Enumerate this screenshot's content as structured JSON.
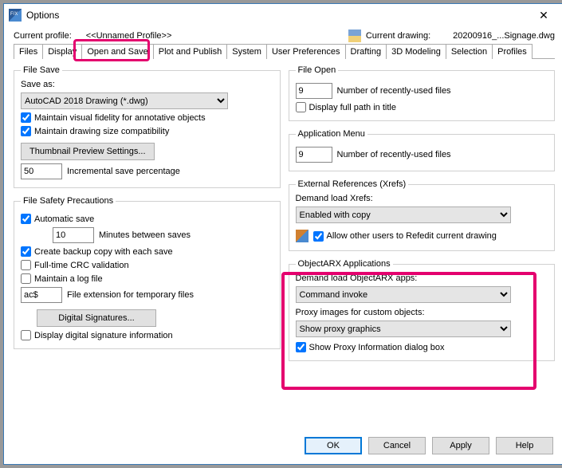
{
  "window": {
    "title": "Options",
    "close": "✕"
  },
  "header": {
    "current_profile_lbl": "Current profile:",
    "profile_name": "<<Unnamed Profile>>",
    "current_drawing_lbl": "Current drawing:",
    "drawing_name": "20200916_...Signage.dwg"
  },
  "tabs": {
    "files": "Files",
    "display": "Display",
    "open_and_save": "Open and Save",
    "plot_and_publish": "Plot and Publish",
    "system": "System",
    "user_prefs": "User Preferences",
    "drafting": "Drafting",
    "modeling": "3D Modeling",
    "selection": "Selection",
    "profiles": "Profiles"
  },
  "file_save": {
    "legend": "File Save",
    "save_as_lbl": "Save as:",
    "save_as_value": "AutoCAD 2018 Drawing (*.dwg)",
    "maintain_visual": "Maintain visual fidelity for annotative objects",
    "maintain_size": "Maintain drawing size compatibility",
    "thumb_btn": "Thumbnail Preview Settings...",
    "incr_value": "50",
    "incr_lbl": "Incremental save percentage"
  },
  "safety": {
    "legend": "File Safety Precautions",
    "auto_save": "Automatic save",
    "minutes_value": "10",
    "minutes_lbl": "Minutes between saves",
    "backup": "Create backup copy with each save",
    "crc": "Full-time CRC validation",
    "logfile": "Maintain a log file",
    "ext_value": "ac$",
    "ext_lbl": "File extension for temporary files",
    "dsig_btn": "Digital Signatures...",
    "dsig_info": "Display digital signature information"
  },
  "file_open": {
    "legend": "File Open",
    "recent_value": "9",
    "recent_lbl": "Number of recently-used files",
    "fullpath": "Display full path in title"
  },
  "app_menu": {
    "legend": "Application Menu",
    "recent_value": "9",
    "recent_lbl": "Number of recently-used files"
  },
  "xrefs": {
    "legend": "External References (Xrefs)",
    "demand_lbl": "Demand load Xrefs:",
    "demand_value": "Enabled with copy",
    "allow_refedit": "Allow other users to Refedit current drawing"
  },
  "arx": {
    "legend": "ObjectARX Applications",
    "demand_lbl": "Demand load ObjectARX apps:",
    "demand_value": "Command invoke",
    "proxy_lbl": "Proxy images for custom objects:",
    "proxy_value": "Show proxy graphics",
    "show_proxy_info": "Show Proxy Information dialog box"
  },
  "footer": {
    "ok": "OK",
    "cancel": "Cancel",
    "apply": "Apply",
    "help": "Help"
  }
}
